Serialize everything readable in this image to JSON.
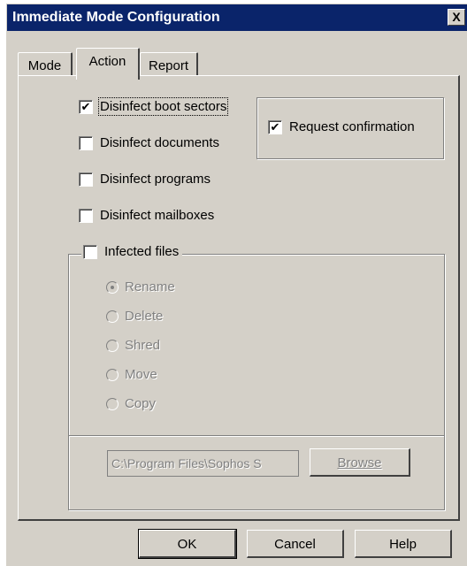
{
  "window": {
    "title": "Immediate Mode Configuration",
    "close_label": "X"
  },
  "tabs": [
    {
      "label": "Mode",
      "selected": false
    },
    {
      "label": "Action",
      "selected": true
    },
    {
      "label": "Report",
      "selected": false
    }
  ],
  "options": {
    "boot_sectors": {
      "label": "Disinfect boot sectors",
      "checked": true
    },
    "documents": {
      "label": "Disinfect documents",
      "checked": false
    },
    "programs": {
      "label": "Disinfect programs",
      "checked": false
    },
    "mailboxes": {
      "label": "Disinfect mailboxes",
      "checked": false
    },
    "request_confirmation": {
      "label": "Request confirmation",
      "checked": true
    },
    "infected_files": {
      "label": "Infected files",
      "checked": false
    }
  },
  "infected_actions": [
    {
      "label": "Rename",
      "selected": true
    },
    {
      "label": "Delete",
      "selected": false
    },
    {
      "label": "Shred",
      "selected": false
    },
    {
      "label": "Move",
      "selected": false
    },
    {
      "label": "Copy",
      "selected": false
    }
  ],
  "destination": {
    "path": "C:\\Program Files\\Sophos S",
    "browse_label": "Browse"
  },
  "footer": {
    "ok_label": "OK",
    "cancel_label": "Cancel",
    "help_label": "Help"
  },
  "check_glyph": "✔",
  "colors": {
    "titlebar": "#0a246a",
    "face": "#d4d0c8",
    "disabled_text": "#808080"
  }
}
